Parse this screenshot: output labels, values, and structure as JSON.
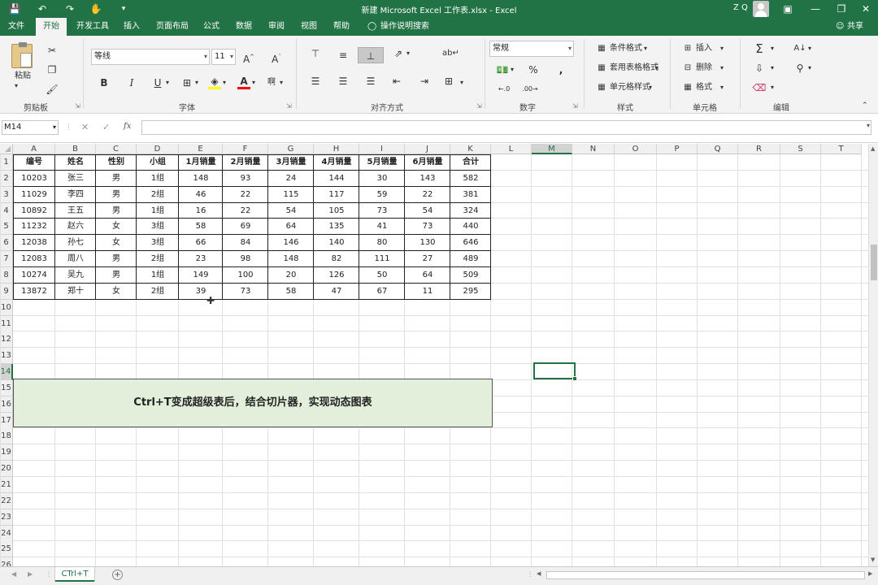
{
  "titlebar": {
    "title": "新建 Microsoft Excel 工作表.xlsx  -  Excel",
    "user": "Z Q",
    "bg": "#217346"
  },
  "tabs": [
    "文件",
    "开始",
    "开发工具",
    "插入",
    "页面布局",
    "公式",
    "数据",
    "审阅",
    "视图",
    "帮助"
  ],
  "active_tab": "开始",
  "tell_me": "操作说明搜索",
  "share": "共享",
  "ribbon": {
    "clipboard": {
      "label": "剪贴板",
      "paste": "粘贴"
    },
    "font": {
      "label": "字体",
      "name": "等线",
      "size": "11",
      "bold": "B",
      "italic": "I",
      "underline": "U"
    },
    "align": {
      "label": "对齐方式"
    },
    "number": {
      "label": "数字",
      "format": "常规",
      "percent": "%",
      "comma": ","
    },
    "styles": {
      "label": "样式",
      "cond_format": "条件格式",
      "table_format": "套用表格格式",
      "cell_style": "单元格样式"
    },
    "cells": {
      "label": "单元格",
      "insert": "插入",
      "delete": "删除",
      "format": "格式"
    },
    "edit": {
      "label": "编辑"
    }
  },
  "formula_bar": {
    "name_box": "M14",
    "fx": "fx",
    "content": ""
  },
  "columns": [
    "A",
    "B",
    "C",
    "D",
    "E",
    "F",
    "G",
    "H",
    "I",
    "J",
    "K",
    "L",
    "M",
    "N",
    "O",
    "P",
    "Q",
    "R",
    "S",
    "T"
  ],
  "selected_column": "M",
  "rows": [
    "1",
    "2",
    "3",
    "4",
    "5",
    "6",
    "7",
    "8",
    "9",
    "10",
    "11",
    "12",
    "13",
    "14",
    "15",
    "16",
    "17",
    "18",
    "19",
    "20",
    "21",
    "22",
    "23",
    "24",
    "25",
    "26"
  ],
  "selected_row": "14",
  "table": {
    "headers": [
      "编号",
      "姓名",
      "性别",
      "小组",
      "1月销量",
      "2月销量",
      "3月销量",
      "4月销量",
      "5月销量",
      "6月销量",
      "合计"
    ],
    "rows": [
      [
        "10203",
        "张三",
        "男",
        "1组",
        "148",
        "93",
        "24",
        "144",
        "30",
        "143",
        "582"
      ],
      [
        "11029",
        "李四",
        "男",
        "2组",
        "46",
        "22",
        "115",
        "117",
        "59",
        "22",
        "381"
      ],
      [
        "10892",
        "王五",
        "男",
        "1组",
        "16",
        "22",
        "54",
        "105",
        "73",
        "54",
        "324"
      ],
      [
        "11232",
        "赵六",
        "女",
        "3组",
        "58",
        "69",
        "64",
        "135",
        "41",
        "73",
        "440"
      ],
      [
        "12038",
        "孙七",
        "女",
        "3组",
        "66",
        "84",
        "146",
        "140",
        "80",
        "130",
        "646"
      ],
      [
        "12083",
        "周八",
        "男",
        "2组",
        "23",
        "98",
        "148",
        "82",
        "111",
        "27",
        "489"
      ],
      [
        "10274",
        "吴九",
        "男",
        "1组",
        "149",
        "100",
        "20",
        "126",
        "50",
        "64",
        "509"
      ],
      [
        "13872",
        "郑十",
        "女",
        "2组",
        "39",
        "73",
        "58",
        "47",
        "67",
        "11",
        "295"
      ]
    ]
  },
  "banner": {
    "text": "Ctrl+T变成超级表后，结合切片器，实现动态图表",
    "bg": "#e2efda"
  },
  "sheet_tab": "CTrl+T"
}
